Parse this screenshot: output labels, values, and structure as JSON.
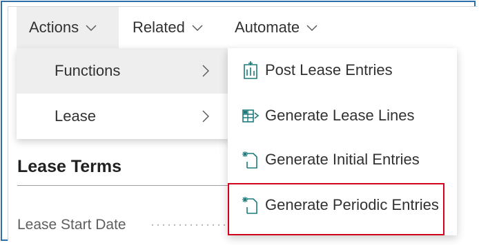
{
  "menu": {
    "tabs": [
      {
        "label": "Actions"
      },
      {
        "label": "Related"
      },
      {
        "label": "Automate"
      }
    ]
  },
  "actions_menu": {
    "items": [
      {
        "label": "Functions"
      },
      {
        "label": "Lease"
      }
    ]
  },
  "functions_submenu": {
    "items": [
      {
        "label": "Post Lease Entries",
        "icon": "post-entries-icon"
      },
      {
        "label": "Generate Lease Lines",
        "icon": "generate-lines-icon"
      },
      {
        "label": "Generate Initial Entries",
        "icon": "new-document-icon"
      },
      {
        "label": "Generate Periodic Entries",
        "icon": "new-document-icon"
      }
    ],
    "highlighted_item": "Generate Periodic Entries",
    "highlight_color": "#d0021b"
  },
  "page": {
    "section_title": "Lease Terms",
    "field_label": "Lease Start Date"
  },
  "colors": {
    "frame_border": "#2d6ea8",
    "icon_teal": "#1e7a7a",
    "text": "#323130"
  }
}
